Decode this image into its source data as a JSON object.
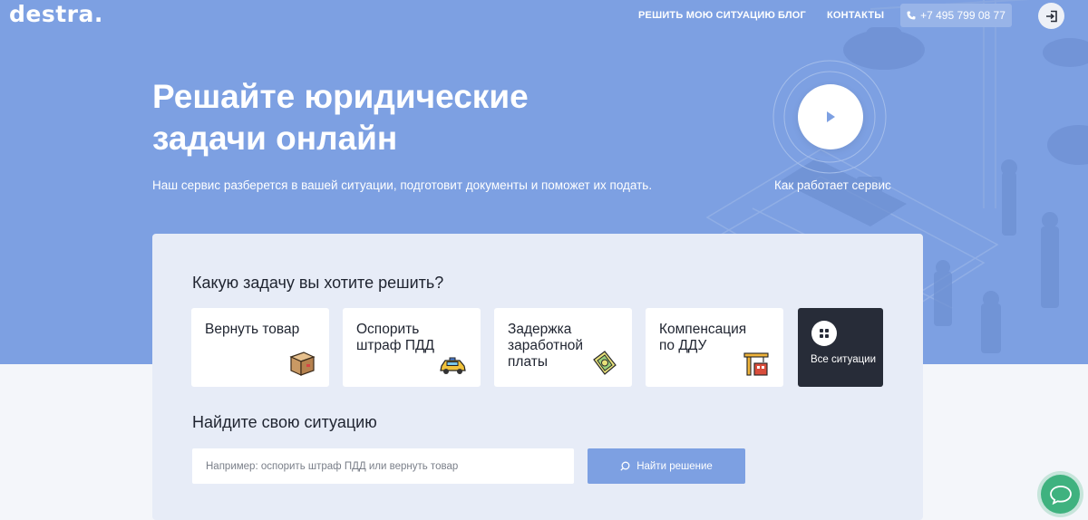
{
  "header": {
    "logo": "destra.",
    "nav": [
      "РЕШИТЬ МОЮ СИТУАЦИЮ",
      "БЛОГ",
      "КОНТАКТЫ"
    ],
    "phone": "+7 495 799 08 77"
  },
  "hero": {
    "title_line1": "Решайте юридические",
    "title_line2": "задачи онлайн",
    "subtitle": "Наш сервис разберется в вашей ситуации, подготовит документы и поможет их подать.",
    "video_caption": "Как работает сервис"
  },
  "tasks": {
    "heading": "Какую задачу вы хотите решить?",
    "items": [
      {
        "label": "Вернуть товар",
        "icon": "box-icon"
      },
      {
        "label": "Оспорить штраф ПДД",
        "icon": "car-icon"
      },
      {
        "label": "Задержка заработной платы",
        "icon": "money-icon"
      },
      {
        "label": "Компенсация по ДДУ",
        "icon": "construction-icon"
      }
    ],
    "all_label": "Все ситуации"
  },
  "search": {
    "heading": "Найдите свою ситуацию",
    "placeholder": "Например: оспорить штраф ПДД или вернуть товар",
    "button_label": "Найти решение"
  },
  "colors": {
    "hero_bg": "#7da0e2",
    "card_bg": "#e7ecf7",
    "dark_tile": "#272c38",
    "accent": "#7da0e2",
    "chat": "#3fb27f"
  }
}
